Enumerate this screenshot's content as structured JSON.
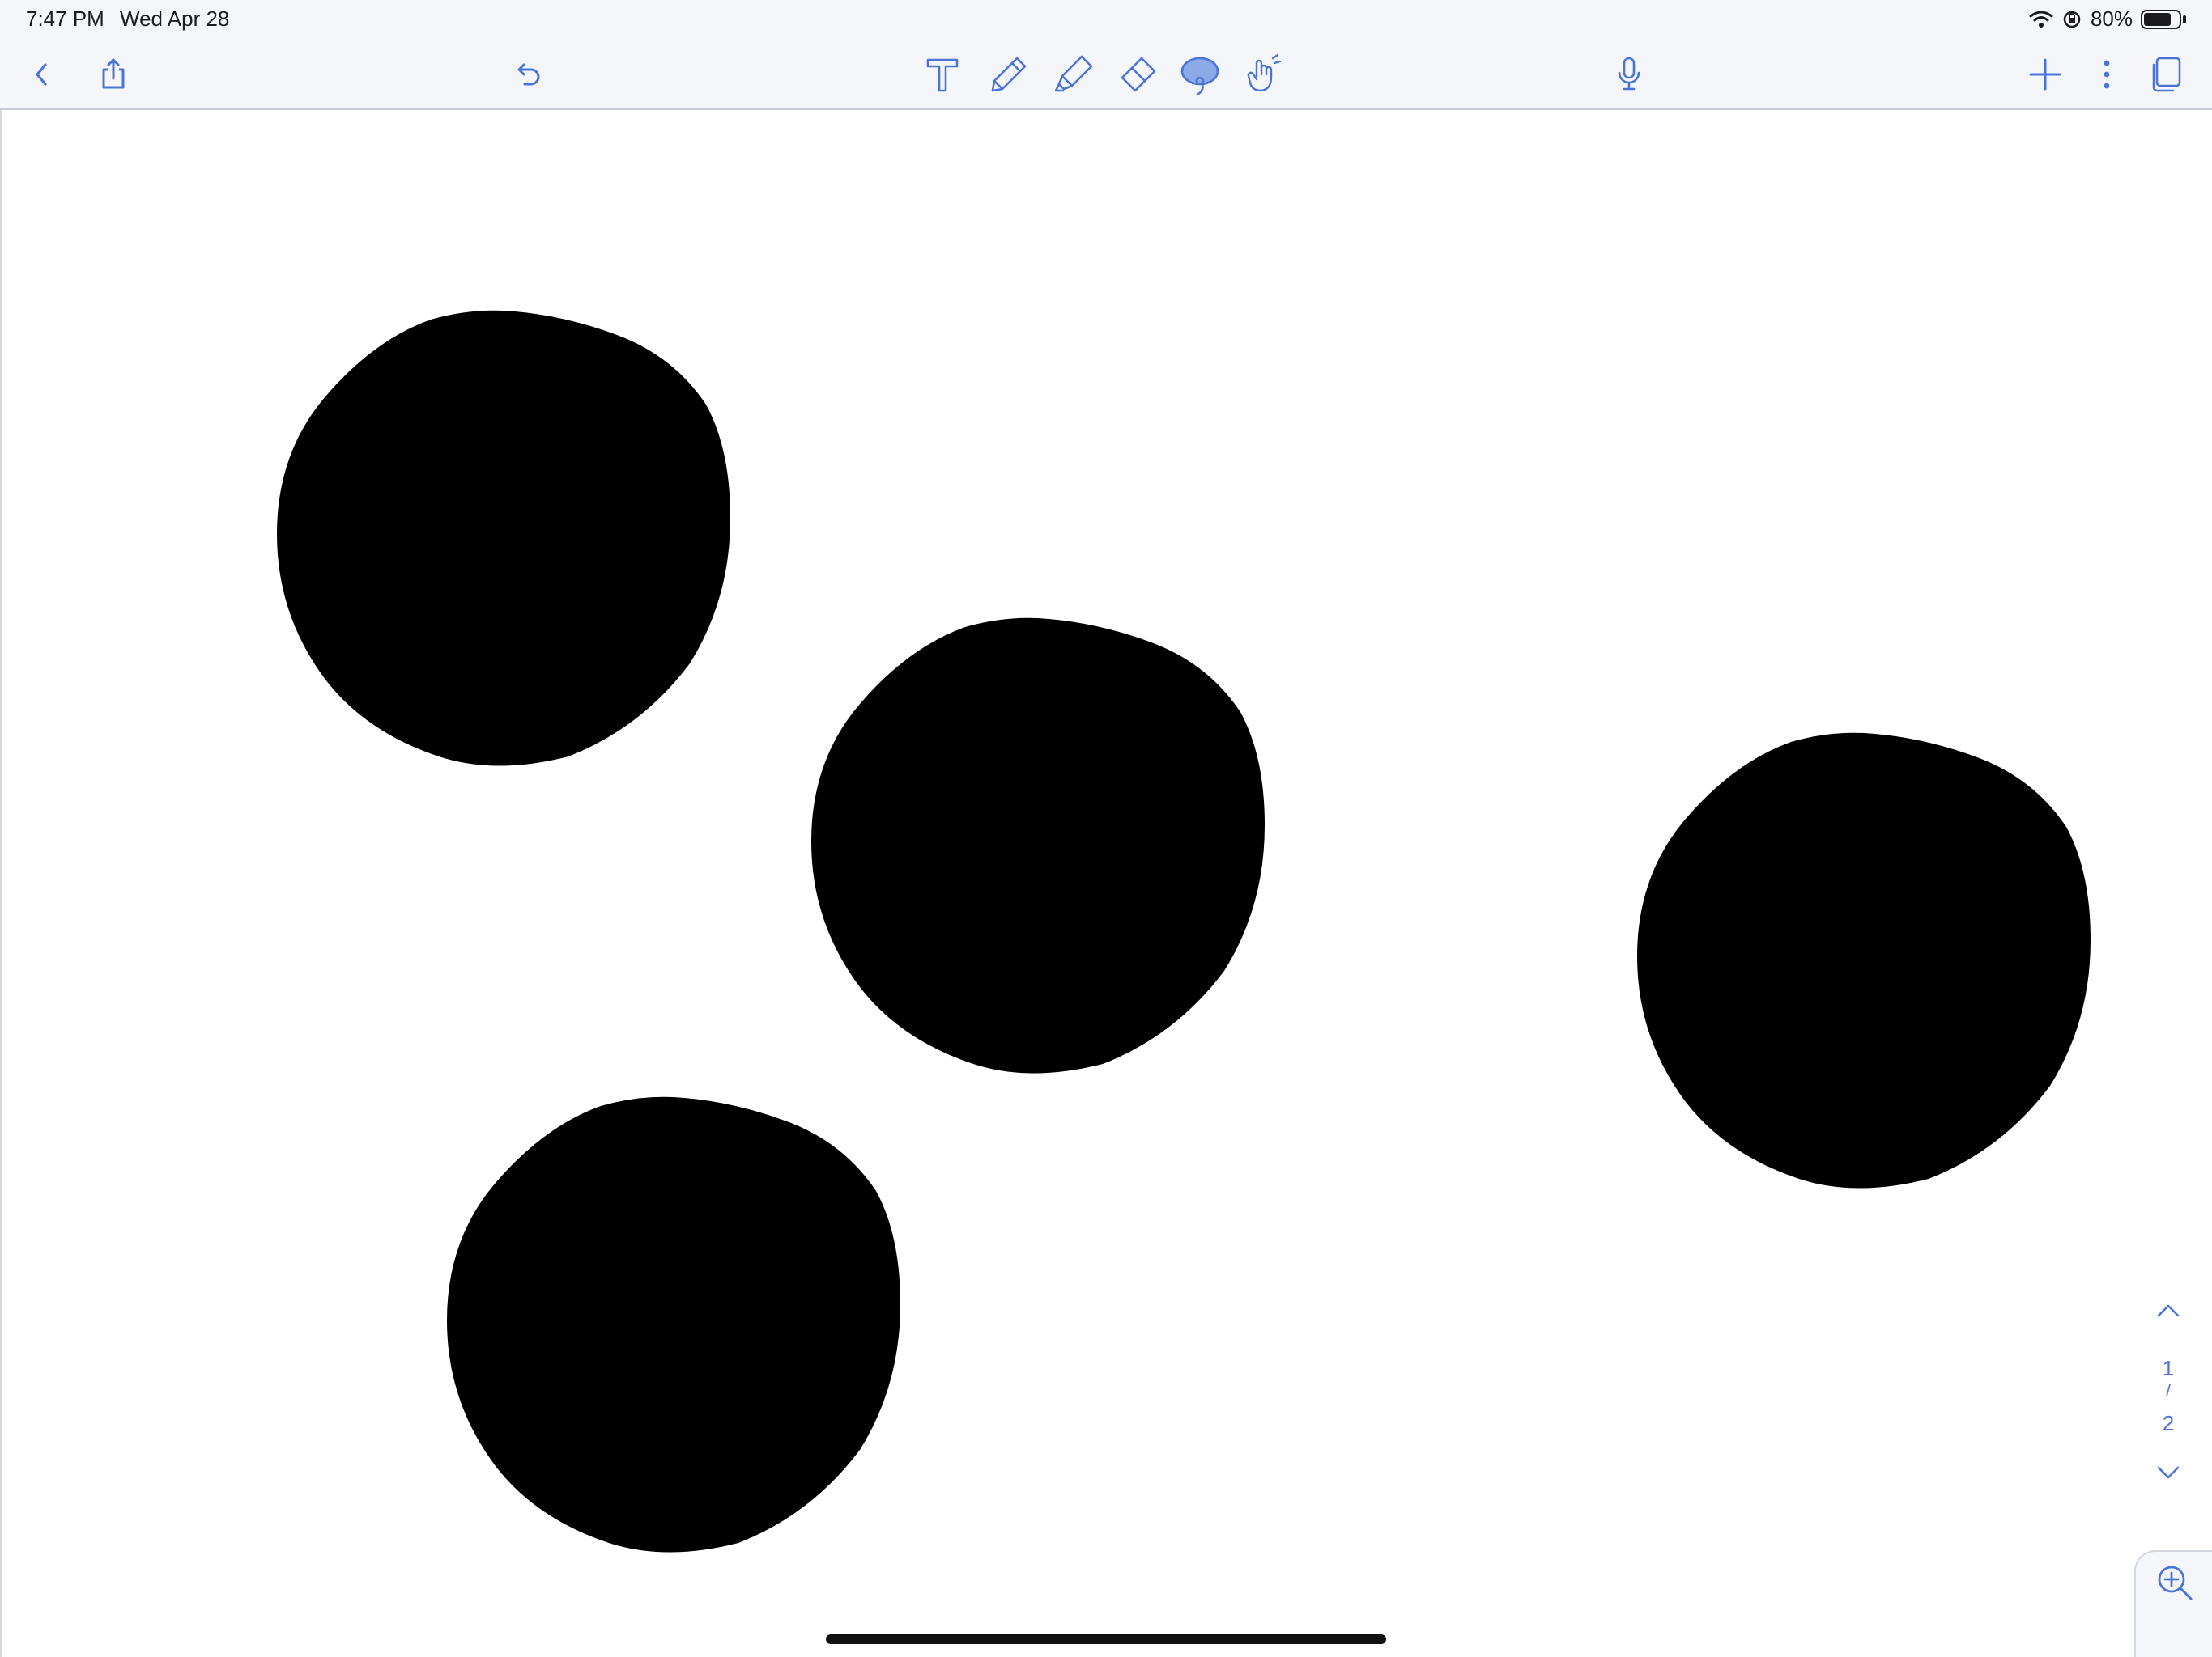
{
  "status_bar": {
    "time": "7:47 PM",
    "date": "Wed Apr 28",
    "battery_percent": "80%",
    "battery_level": 0.8
  },
  "toolbar": {
    "left": [
      {
        "icon": "back-icon"
      },
      {
        "icon": "share-icon"
      },
      {
        "icon": "undo-icon"
      }
    ],
    "tools": [
      {
        "icon": "text-tool-icon"
      },
      {
        "icon": "pen-tool-icon"
      },
      {
        "icon": "highlighter-tool-icon"
      },
      {
        "icon": "eraser-tool-icon"
      },
      {
        "icon": "lasso-tool-icon",
        "selected": true
      },
      {
        "icon": "hand-tool-icon"
      }
    ],
    "right": [
      {
        "icon": "microphone-icon"
      },
      {
        "icon": "add-icon"
      },
      {
        "icon": "more-icon"
      },
      {
        "icon": "pages-icon"
      }
    ]
  },
  "canvas": {
    "strokes": [
      {
        "shape": "filled-circle",
        "color": "#000000"
      },
      {
        "shape": "filled-circle",
        "color": "#000000"
      },
      {
        "shape": "filled-circle",
        "color": "#000000"
      },
      {
        "shape": "filled-circle",
        "color": "#000000"
      }
    ]
  },
  "page_nav": {
    "current": "1",
    "separator": "/",
    "total": "2"
  },
  "colors": {
    "accent": "#4a74d8",
    "toolbar_bg": "#f5f6fa",
    "lasso_fill": "#8aaae8"
  }
}
